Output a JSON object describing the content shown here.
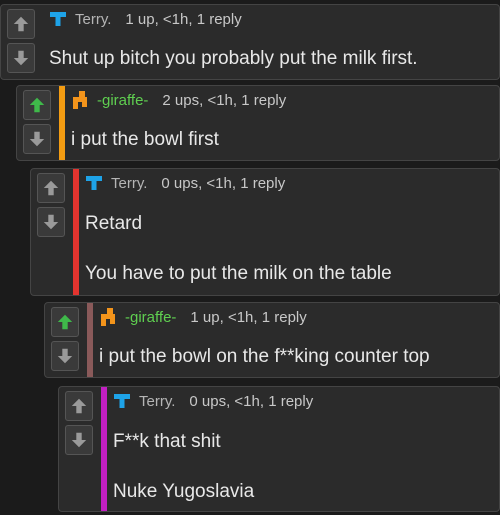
{
  "colors": {
    "background": "#1b1b1b",
    "card": "#2b2b2b",
    "upvote_active": "#3fb94a",
    "vote_inactive": "#9a9a9a",
    "terry_avatar": "#1ea3e8",
    "giraffe_avatar": "#f3941b",
    "giraffe_name": "#5fcf50"
  },
  "comments": [
    {
      "username": "Terry.",
      "avatar_icon": "t-letter-icon",
      "upvoted": false,
      "bar_color": "",
      "stats": "1 up, <1h, 1 reply",
      "lines": [
        "Shut up bitch you probably put the milk first."
      ]
    },
    {
      "username": "-giraffe-",
      "avatar_icon": "orange-pixel-icon",
      "upvoted": true,
      "bar_color": "#f39c12",
      "stats": "2 ups, <1h, 1 reply",
      "lines": [
        "i put the bowl first"
      ]
    },
    {
      "username": "Terry.",
      "avatar_icon": "t-letter-icon",
      "upvoted": false,
      "bar_color": "#e3342f",
      "stats": "0 ups, <1h, 1 reply",
      "lines": [
        "Retard",
        "You have to put the milk on the table"
      ]
    },
    {
      "username": "-giraffe-",
      "avatar_icon": "orange-pixel-icon",
      "upvoted": true,
      "bar_color": "#8a5a5a",
      "stats": "1 up, <1h, 1 reply",
      "lines": [
        "i put the bowl on the f**king counter top"
      ]
    },
    {
      "username": "Terry.",
      "avatar_icon": "t-letter-icon",
      "upvoted": false,
      "bar_color": "#c21fc2",
      "stats": "0 ups, <1h, 1 reply",
      "lines": [
        "F**k that shit",
        "Nuke Yugoslavia"
      ]
    }
  ]
}
